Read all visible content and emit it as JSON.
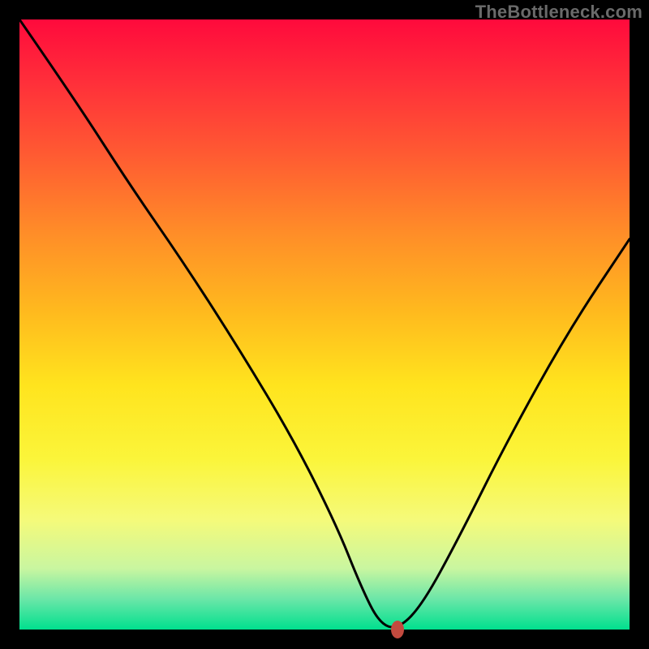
{
  "watermark": "TheBottleneck.com",
  "chart_data": {
    "type": "line",
    "title": "",
    "xlabel": "",
    "ylabel": "",
    "xlim": [
      0,
      100
    ],
    "ylim": [
      0,
      100
    ],
    "grid": false,
    "series": [
      {
        "name": "curve",
        "x": [
          0,
          9,
          18,
          27,
          36,
          45,
          52,
          56,
          59,
          62,
          66,
          72,
          80,
          90,
          100
        ],
        "y": [
          100,
          87,
          73,
          60,
          46,
          31,
          17,
          7,
          1,
          0,
          4,
          15,
          31,
          49,
          64
        ]
      }
    ],
    "marker": {
      "x": 62,
      "y": 0,
      "color": "#c34a3f"
    },
    "background_gradient": {
      "direction": "top-to-bottom",
      "stops": [
        {
          "pos": 0,
          "color": "#ff0a3c"
        },
        {
          "pos": 50,
          "color": "#ffba1e"
        },
        {
          "pos": 100,
          "color": "#00e08e"
        }
      ]
    }
  }
}
